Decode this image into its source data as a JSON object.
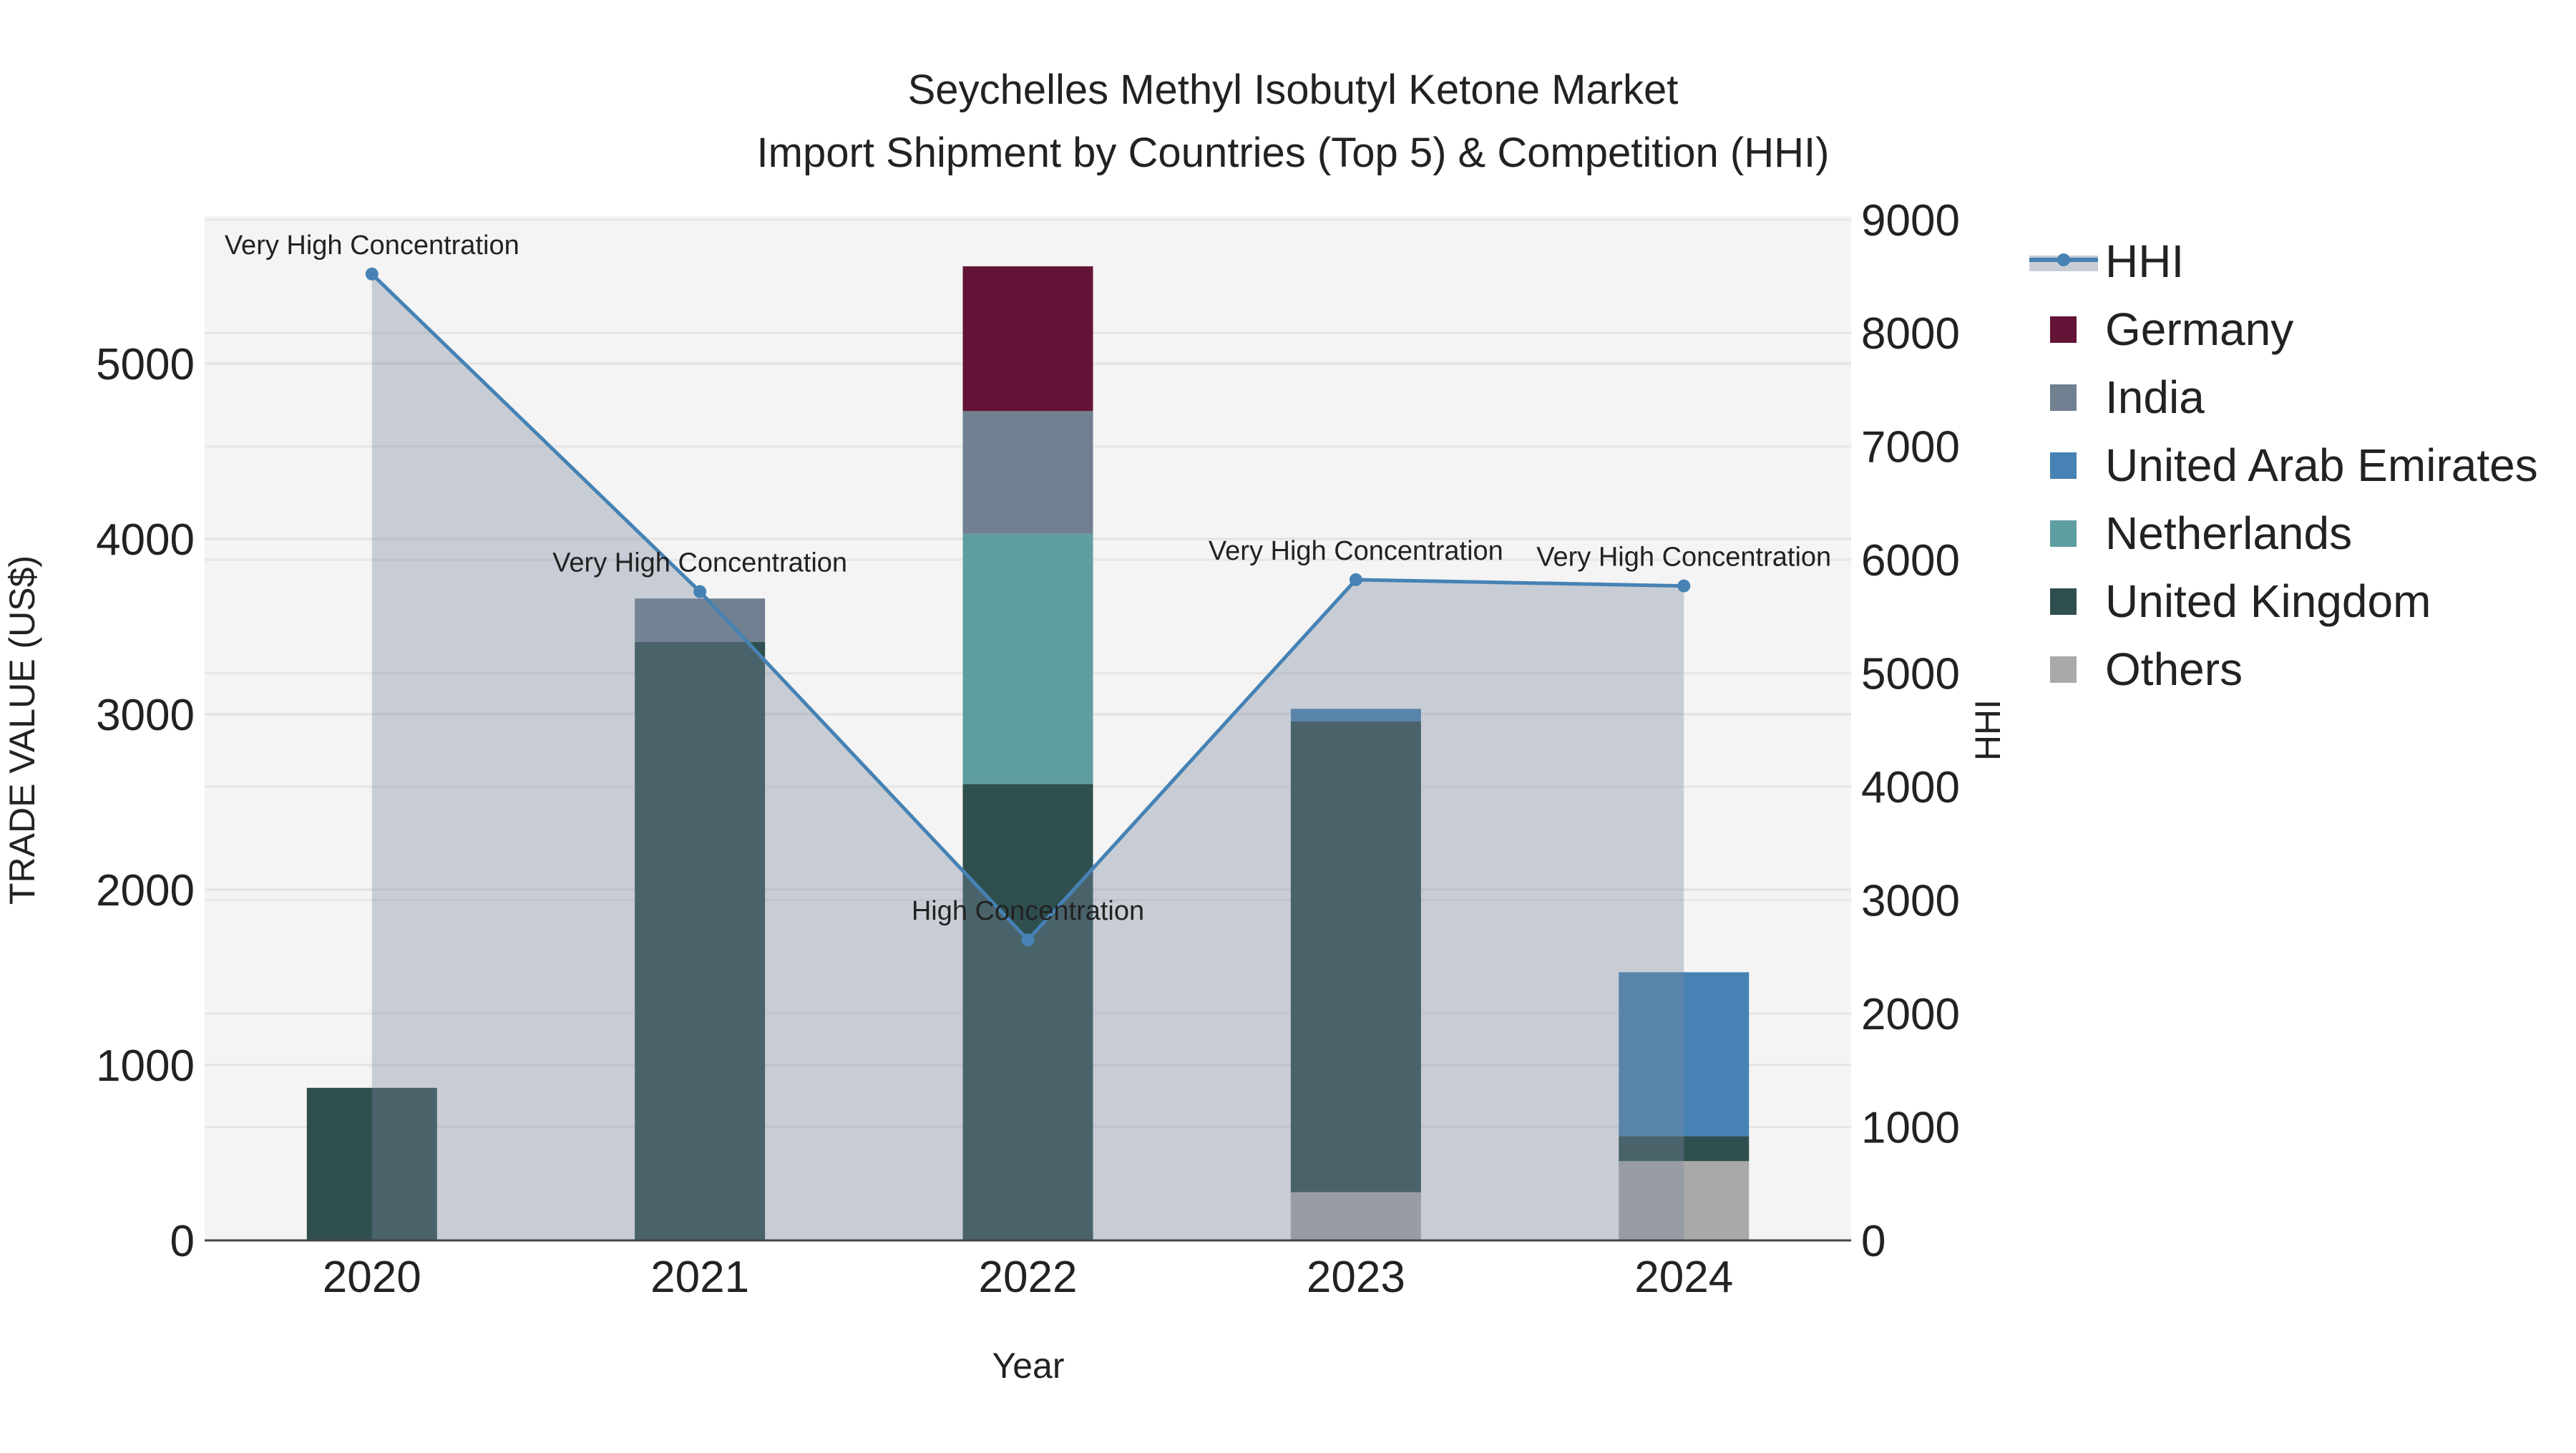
{
  "chart_data": {
    "type": "bar",
    "title": "Seychelles Methyl Isobutyl Ketone Market",
    "subtitle": "Import Shipment by Countries (Top 5) & Competition (HHI)",
    "xlabel": "Year",
    "ylabel": "TRADE VALUE (US$)",
    "y2label": "HHI",
    "categories": [
      "2020",
      "2021",
      "2022",
      "2023",
      "2024"
    ],
    "ylim": [
      0,
      5840
    ],
    "y2lim": [
      0,
      9030
    ],
    "yticks": [
      0,
      1000,
      2000,
      3000,
      4000,
      5000
    ],
    "y2ticks": [
      0,
      1000,
      2000,
      3000,
      4000,
      5000,
      6000,
      7000,
      8000,
      9000
    ],
    "grid": true,
    "stacked": true,
    "legend_position": "right",
    "series": [
      {
        "name": "Others",
        "color": "#A9A9A9",
        "values": [
          0,
          0,
          0,
          275,
          452
        ]
      },
      {
        "name": "United Kingdom",
        "color": "#2F4F4F",
        "values": [
          870,
          3412,
          2602,
          2685,
          142
        ]
      },
      {
        "name": "Netherlands",
        "color": "#5F9EA0",
        "values": [
          0,
          0,
          1427,
          0,
          0
        ]
      },
      {
        "name": "United Arab Emirates",
        "color": "#4682B4",
        "values": [
          0,
          0,
          0,
          71,
          935
        ]
      },
      {
        "name": "India",
        "color": "#708090",
        "values": [
          0,
          248,
          700,
          0,
          0
        ]
      },
      {
        "name": "Germany",
        "color": "#631335",
        "values": [
          0,
          0,
          825,
          0,
          0
        ]
      }
    ],
    "hhi": {
      "name": "HHI",
      "color": "#4682B4",
      "values": [
        8520,
        5720,
        2650,
        5825,
        5770
      ],
      "annotations": [
        "Very High Concentration",
        "Very High Concentration",
        "High Concentration",
        "Very High Concentration",
        "Very High Concentration"
      ]
    },
    "legend_order": [
      "HHI",
      "Germany",
      "India",
      "United Arab Emirates",
      "Netherlands",
      "United Kingdom",
      "Others"
    ]
  }
}
